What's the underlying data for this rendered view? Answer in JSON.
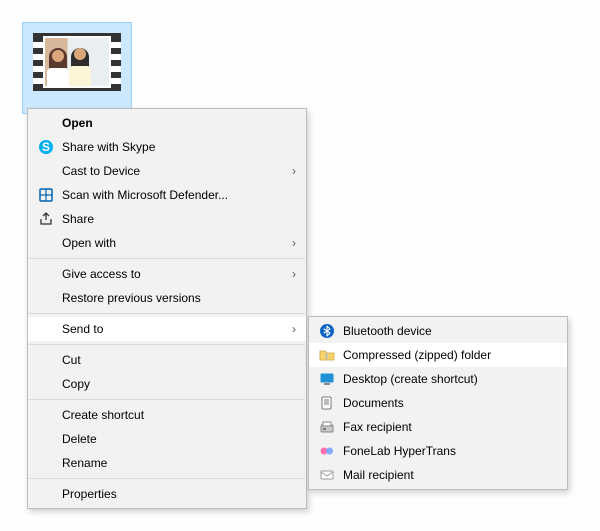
{
  "file": {
    "type": "video"
  },
  "context_menu": {
    "items": [
      {
        "label": "Open",
        "bold": true
      },
      {
        "label": "Share with Skype",
        "icon": "skype"
      },
      {
        "label": "Cast to Device",
        "submenu": true
      },
      {
        "label": "Scan with Microsoft Defender...",
        "icon": "defender"
      },
      {
        "label": "Share",
        "icon": "share"
      },
      {
        "label": "Open with",
        "submenu": true
      }
    ],
    "items2": [
      {
        "label": "Give access to",
        "submenu": true
      },
      {
        "label": "Restore previous versions"
      }
    ],
    "items3": [
      {
        "label": "Send to",
        "submenu": true,
        "hover": true
      }
    ],
    "items4": [
      {
        "label": "Cut"
      },
      {
        "label": "Copy"
      }
    ],
    "items5": [
      {
        "label": "Create shortcut"
      },
      {
        "label": "Delete"
      },
      {
        "label": "Rename"
      }
    ],
    "items6": [
      {
        "label": "Properties"
      }
    ]
  },
  "sendto_menu": [
    {
      "label": "Bluetooth device",
      "icon": "bluetooth"
    },
    {
      "label": "Compressed (zipped) folder",
      "icon": "zip",
      "hover": true
    },
    {
      "label": "Desktop (create shortcut)",
      "icon": "desktop"
    },
    {
      "label": "Documents",
      "icon": "documents"
    },
    {
      "label": "Fax recipient",
      "icon": "fax"
    },
    {
      "label": "FoneLab HyperTrans",
      "icon": "hypertrans"
    },
    {
      "label": "Mail recipient",
      "icon": "mail"
    }
  ]
}
